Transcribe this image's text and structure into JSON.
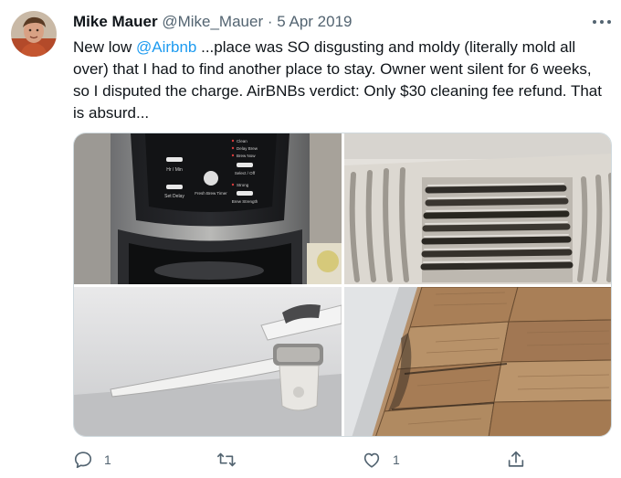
{
  "tweet": {
    "author": {
      "name": "Mike Mauer",
      "handle": "@Mike_Mauer",
      "separator": "·",
      "date": "5 Apr 2019"
    },
    "text": {
      "before_mention": "New low ",
      "mention": "@Airbnb",
      "after_mention": " ...place was SO disgusting and moldy (literally mold all over) that I had to find another place to stay.  Owner went silent for 6 weeks, so I disputed the charge.  AirBNBs verdict: Only $30 cleaning fee refund. That is absurd..."
    },
    "coffee_maker_buttons": {
      "hr_min": "Hr / Min",
      "set_delay": "Set Delay",
      "fresh_brew_timer": "Fresh Brew Timer",
      "clean": "Clean",
      "delay_brew": "Delay Brew",
      "brew_now": "Brew Now",
      "select_off": "Select / Off",
      "strong": "Strong",
      "brew_strength": "Brew Strength"
    },
    "actions": {
      "reply_count": "1",
      "retweet_count": "",
      "like_count": "1"
    },
    "icons": {
      "more": "more-horizontal-icon",
      "reply": "reply-icon",
      "retweet": "retweet-icon",
      "like": "heart-icon",
      "share": "share-icon"
    },
    "colors": {
      "link": "#1d9bf0",
      "secondary_text": "#536471",
      "text": "#0f1419"
    }
  }
}
